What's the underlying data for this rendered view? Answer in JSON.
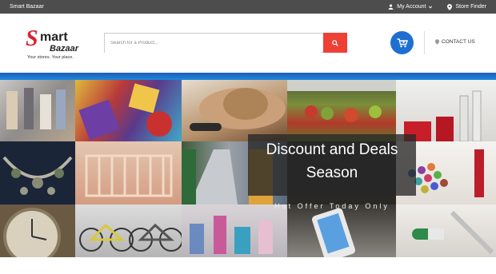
{
  "topbar": {
    "brand": "Smart Bazaar",
    "account_label": "My Account",
    "store_finder_label": "Store Finder"
  },
  "logo": {
    "s": "S",
    "mart": "mart",
    "bazaar": "Bazaar",
    "tagline": "Your stores. Your place."
  },
  "search": {
    "placeholder": "Search for a Product..."
  },
  "header": {
    "contact_label": "CONTACT US"
  },
  "banner": {
    "title_line1": "Discount and Deals",
    "title_line2": "Season",
    "subtitle": "Hot Offer Today Only"
  },
  "colors": {
    "accent_red": "#ee4035",
    "accent_blue": "#1e6fd0",
    "topbar": "#4d4d4d"
  },
  "icons": [
    "user-icon",
    "map-marker-icon",
    "search-icon",
    "cart-icon"
  ]
}
